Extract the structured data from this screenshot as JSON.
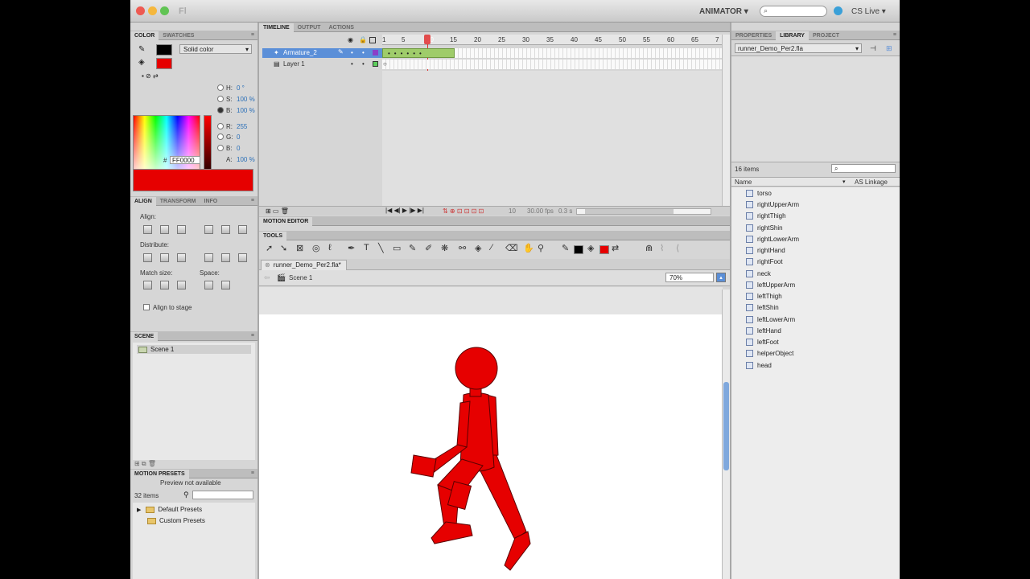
{
  "window": {
    "app_name": "Fl",
    "workspace_label": "ANIMATOR",
    "cslive_label": "CS Live"
  },
  "color_panel": {
    "tabs": [
      "COLOR",
      "SWATCHES"
    ],
    "fill_type": "Solid color",
    "h_label": "H:",
    "h_value": "0 °",
    "s_label": "S:",
    "s_value": "100 %",
    "b_label": "B:",
    "b_value": "100 %",
    "r_label": "R:",
    "r_value": "255",
    "g_label": "G:",
    "g_value": "0",
    "b2_label": "B:",
    "b2_value": "0",
    "a_label": "A:",
    "a_value": "100 %",
    "hex_label": "#",
    "hex_value": "FF0000",
    "swatch_color": "#e60000"
  },
  "align_panel": {
    "tabs": [
      "ALIGN",
      "TRANSFORM",
      "INFO"
    ],
    "align_label": "Align:",
    "distribute_label": "Distribute:",
    "match_size_label": "Match size:",
    "space_label": "Space:",
    "align_to_stage_label": "Align to stage"
  },
  "scene_panel": {
    "tab": "SCENE",
    "item": "Scene 1"
  },
  "motion_presets": {
    "tab": "MOTION PRESETS",
    "preview_text": "Preview not available",
    "count": "32 items",
    "folders": [
      "Default Presets",
      "Custom Presets"
    ]
  },
  "timeline": {
    "tabs": [
      "TIMELINE",
      "OUTPUT",
      "ACTIONS"
    ],
    "layers": [
      "Armature_2",
      "Layer 1"
    ],
    "ruler": [
      "1",
      "5",
      "10",
      "15",
      "20",
      "25",
      "30",
      "35",
      "40",
      "45",
      "50",
      "55",
      "60",
      "65",
      "7"
    ],
    "current_frame": "10",
    "fps": "30.00 fps",
    "elapsed": "0.3 s",
    "frame_field": "10"
  },
  "motion_editor_tab": "MOTION EDITOR",
  "tools_panel_label": "TOOLS",
  "document": {
    "tab": "runner_Demo_Per2.fla*",
    "scene": "Scene 1",
    "zoom": "70%"
  },
  "library": {
    "tabs": [
      "PROPERTIES",
      "LIBRARY",
      "PROJECT"
    ],
    "document": "runner_Demo_Per2.fla",
    "count": "16 items",
    "col_name": "Name",
    "col_linkage": "AS Linkage",
    "items": [
      "torso",
      "rightUpperArm",
      "rightThigh",
      "rightShin",
      "rightLowerArm",
      "rightHand",
      "rightFoot",
      "neck",
      "leftUpperArm",
      "leftThigh",
      "leftShin",
      "leftLowerArm",
      "leftHand",
      "leftFoot",
      "helperObject",
      "head"
    ]
  },
  "colors": {
    "accent_red": "#e60000",
    "layer_selected": "#5b8fd8",
    "tween_green": "#9fcc6a",
    "playhead": "#e03030"
  }
}
